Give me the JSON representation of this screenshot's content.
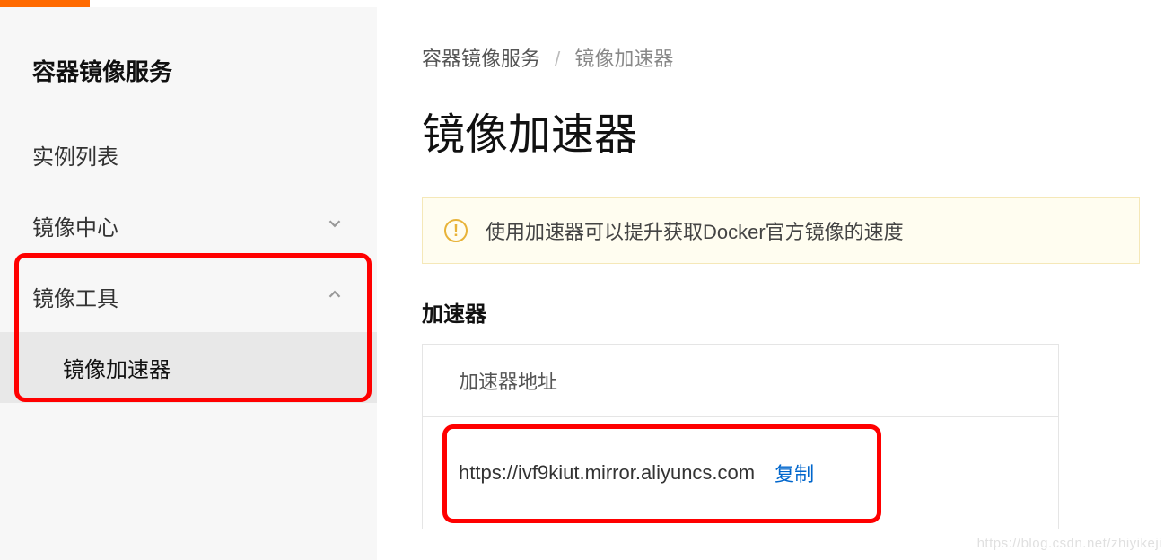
{
  "sidebar": {
    "title": "容器镜像服务",
    "items": [
      {
        "label": "实例列表",
        "chevron": null
      },
      {
        "label": "镜像中心",
        "chevron": "down"
      },
      {
        "label": "镜像工具",
        "chevron": "up"
      },
      {
        "label": "镜像加速器",
        "child": true
      }
    ]
  },
  "breadcrumb": {
    "root": "容器镜像服务",
    "current": "镜像加速器"
  },
  "page": {
    "title": "镜像加速器",
    "notice": "使用加速器可以提升获取Docker官方镜像的速度",
    "section_label": "加速器",
    "card_header": "加速器地址",
    "url": "https://ivf9kiut.mirror.aliyuncs.com",
    "copy_label": "复制"
  },
  "watermark": "https://blog.csdn.net/zhiyikeji"
}
